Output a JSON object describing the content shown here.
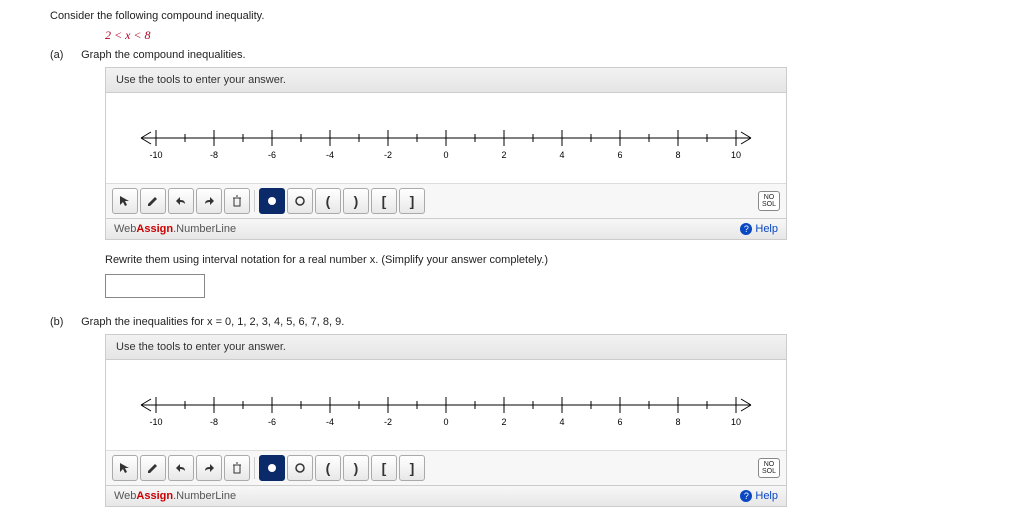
{
  "intro": "Consider the following compound inequality.",
  "inequality": "2 < x < 8",
  "parts": {
    "a": {
      "tag": "(a)",
      "prompt": "Graph the compound inequalities."
    },
    "b": {
      "tag": "(b)",
      "prompt": "Graph the inequalities for x = 0, 1, 2, 3, 4, 5, 6, 7, 8, 9."
    }
  },
  "widget": {
    "instruction": "Use the tools to enter your answer.",
    "brand_web": "Web",
    "brand_assign": "Assign",
    "brand_product": ".NumberLine",
    "help": "Help",
    "no_sol_line1": "NO",
    "no_sol_line2": "SOL"
  },
  "numberline": {
    "min": -10,
    "max": 10,
    "majors": [
      -10,
      -8,
      -6,
      -4,
      -2,
      0,
      2,
      4,
      6,
      8,
      10
    ]
  },
  "tools": {
    "pointer": "pointer-tool",
    "pencil": "pencil-tool",
    "undo": "undo-tool",
    "redo": "redo-tool",
    "delete": "delete-tool",
    "closed_point": "closed-point-tool",
    "open_point": "open-point-tool",
    "open_left": "open-interval-left-tool",
    "open_right": "open-interval-right-tool",
    "closed_left": "closed-interval-left-tool",
    "closed_right": "closed-interval-right-tool"
  },
  "rewrite_prompt": "Rewrite them using interval notation for a real number x. (Simplify your answer completely.)",
  "answer_value": ""
}
